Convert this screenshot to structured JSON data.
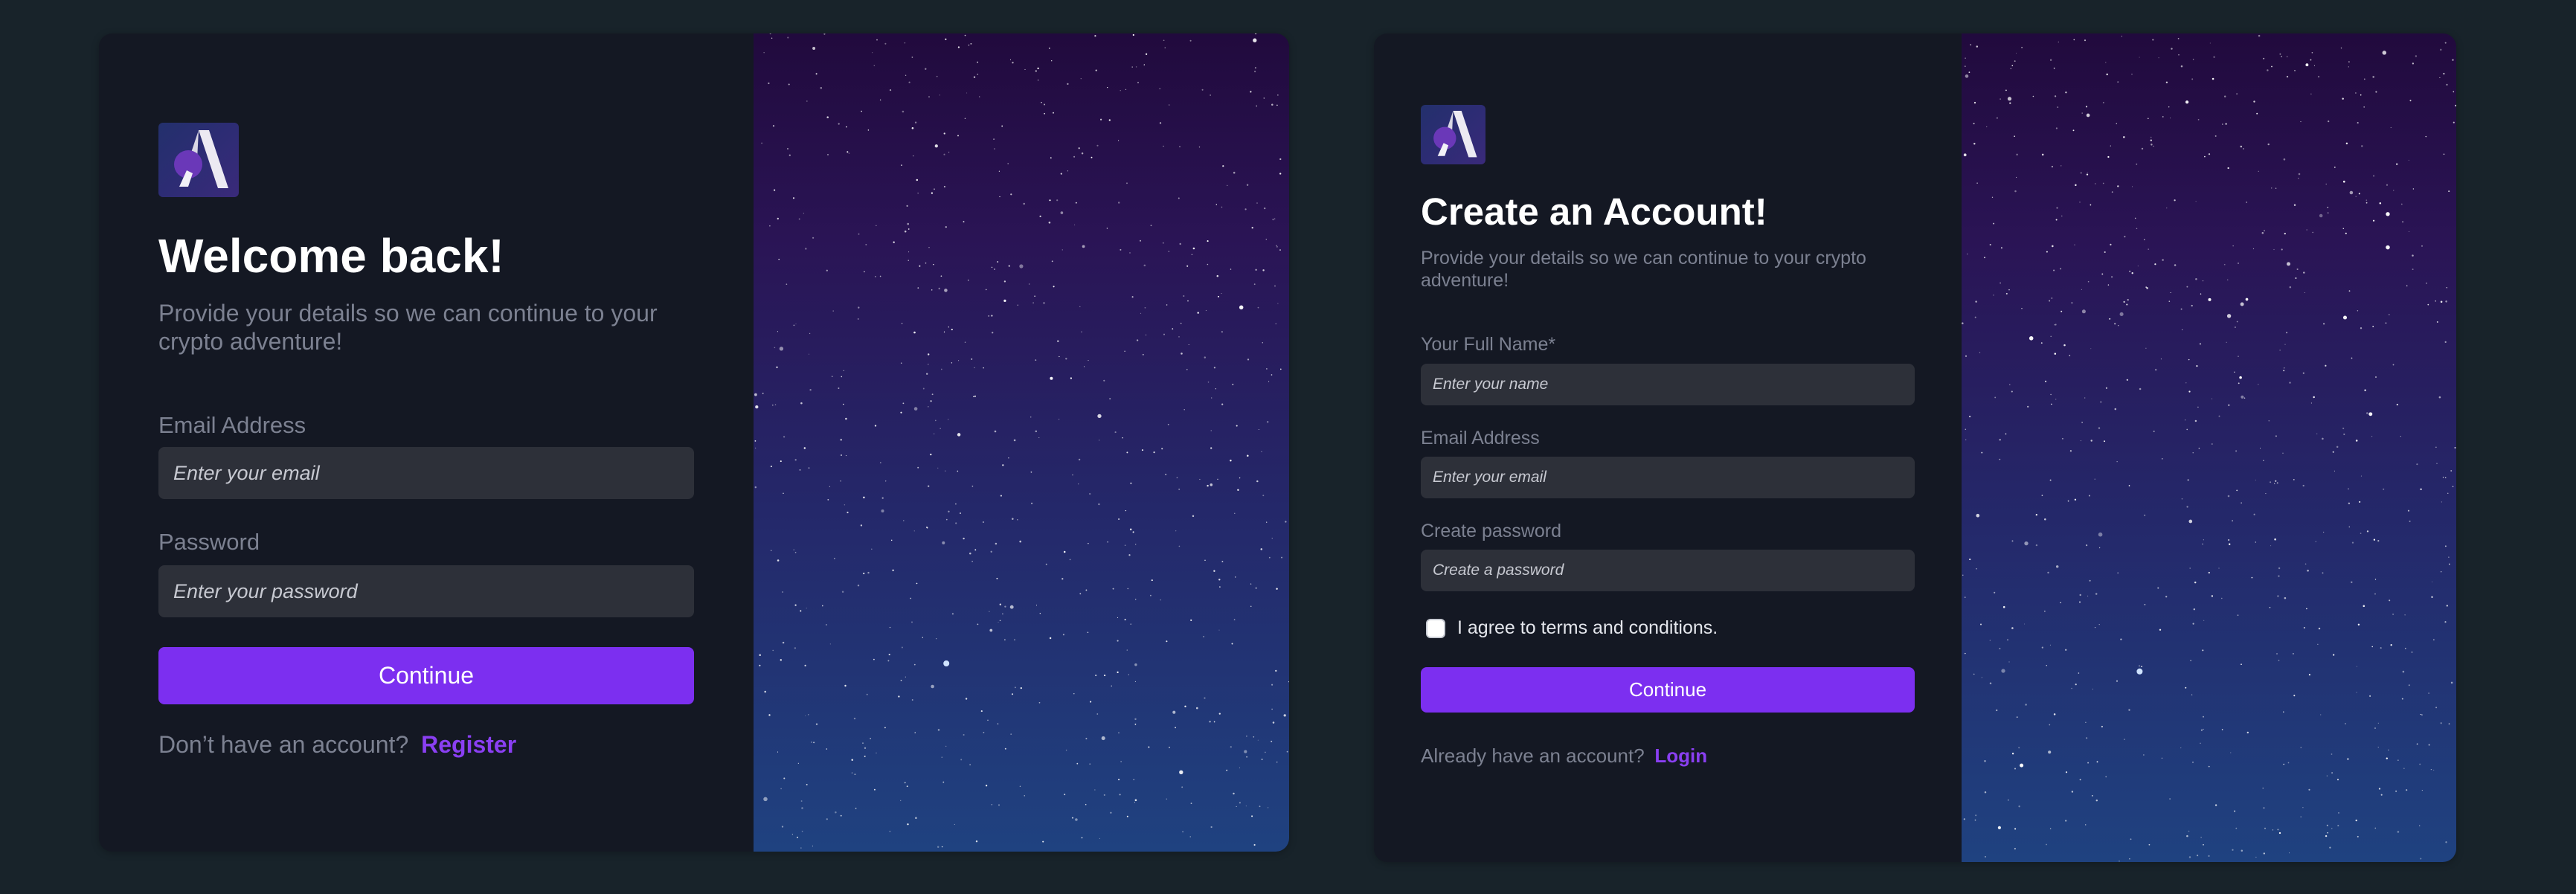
{
  "login": {
    "title": "Welcome back!",
    "subtitle": "Provide your details so we can continue to your crypto adventure!",
    "email_label": "Email Address",
    "email_placeholder": "Enter your email",
    "password_label": "Password",
    "password_placeholder": "Enter your password",
    "continue_label": "Continue",
    "footer_prompt": "Don’t have an account?",
    "footer_link": "Register"
  },
  "register": {
    "title": "Create an Account!",
    "subtitle": "Provide your details so we can continue to your crypto adventure!",
    "name_label": "Your Full Name*",
    "name_placeholder": "Enter your name",
    "email_label": "Email Address",
    "email_placeholder": "Enter your email",
    "password_label": "Create password",
    "password_placeholder": "Create a password",
    "terms_label": "I agree to terms and conditions.",
    "terms_checked": false,
    "continue_label": "Continue",
    "footer_prompt": "Already have an account?",
    "footer_link": "Login"
  },
  "icons": {
    "logo": "app-logo-icon",
    "checkbox": "checkbox-icon"
  },
  "colors": {
    "page_bg": "#18232a",
    "card_bg": "#141823",
    "input_bg": "#2d3039",
    "accent": "#7c2ff0",
    "link": "#8a3ff2",
    "muted_text": "#7c8191"
  }
}
